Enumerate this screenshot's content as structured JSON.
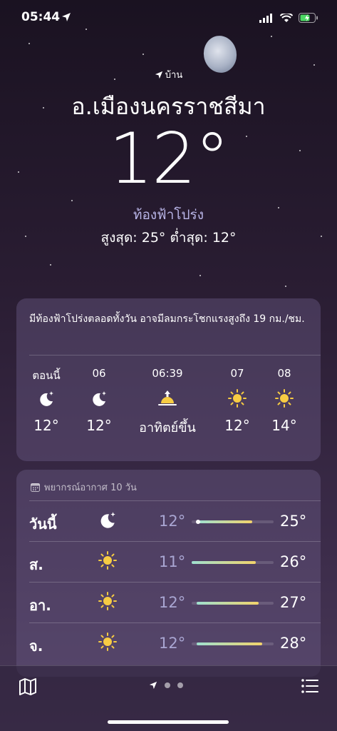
{
  "status_bar": {
    "time": "05:44"
  },
  "header": {
    "home_label": "บ้าน",
    "city": "อ.เมืองนครราชสีมา",
    "temperature": "12°",
    "condition": "ท้องฟ้าโปร่ง",
    "high_low": "สูงสุด: 25°  ต่ำสุด: 12°"
  },
  "hourly": {
    "summary": "มีท้องฟ้าโปร่งตลอดทั้งวัน อาจมีลมกระโชกแรงสูงถึง 19 กม./ชม.",
    "hours": [
      {
        "label": "ตอนนี้",
        "icon": "moon-stars-icon",
        "value": "12°"
      },
      {
        "label": "06",
        "icon": "moon-stars-icon",
        "value": "12°"
      },
      {
        "label": "06:39",
        "icon": "sunrise-icon",
        "value": "อาทิตย์ขึ้น"
      },
      {
        "label": "07",
        "icon": "sun-icon",
        "value": "12°"
      },
      {
        "label": "08",
        "icon": "sun-icon",
        "value": "14°"
      }
    ]
  },
  "daily": {
    "title": "พยากรณ์อากาศ 10 วัน",
    "days": [
      {
        "name": "วันนี้",
        "icon": "moon-stars-icon",
        "low": "12°",
        "high": "25°",
        "bar_start": 0.08,
        "bar_end": 0.74,
        "current": 0.08
      },
      {
        "name": "ส.",
        "icon": "sun-icon",
        "low": "11°",
        "high": "26°",
        "bar_start": 0.0,
        "bar_end": 0.78
      },
      {
        "name": "อา.",
        "icon": "sun-icon",
        "low": "12°",
        "high": "27°",
        "bar_start": 0.06,
        "bar_end": 0.82
      },
      {
        "name": "จ.",
        "icon": "sun-icon",
        "low": "12°",
        "high": "28°",
        "bar_start": 0.06,
        "bar_end": 0.86
      }
    ]
  },
  "bottom_bar": {
    "map_icon": "map-icon",
    "list_icon": "list-icon",
    "pages": 3,
    "current_page": 0
  },
  "colors": {
    "accent": "#b8b4e6",
    "bar_cool": "#9fe0d0",
    "bar_warm": "#f2d36b"
  }
}
